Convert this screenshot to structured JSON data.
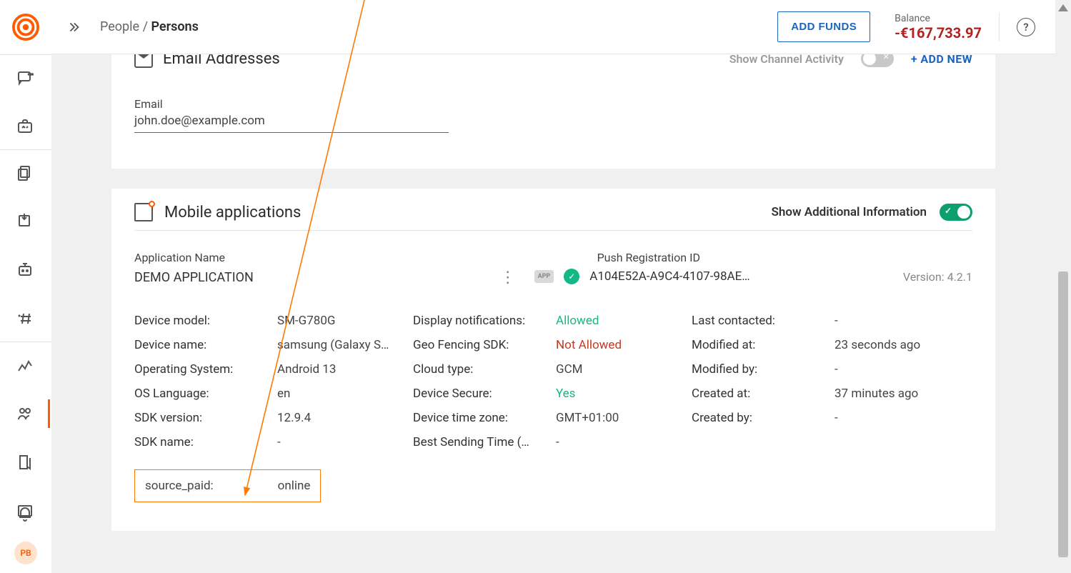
{
  "breadcrumb": {
    "root": "People",
    "sep": "/",
    "leaf": "Persons"
  },
  "header": {
    "add_funds": "ADD FUNDS",
    "balance_label": "Balance",
    "balance_value": "-€167,733.97"
  },
  "avatar": "PB",
  "email_section": {
    "title": "Email Addresses",
    "show_activity": "Show Channel Activity",
    "add_new": "+ ADD NEW",
    "field_label": "Email",
    "field_value": "john.doe@example.com"
  },
  "mobile_section": {
    "title": "Mobile applications",
    "show_info": "Show Additional Information",
    "app_name_label": "Application Name",
    "app_name": "DEMO APPLICATION",
    "push_label": "Push Registration ID",
    "app_badge": "APP",
    "push_id": "A104E52A-A9C4-4107-98AE…",
    "version": "Version: 4.2.1",
    "rows": {
      "device_model_l": "Device model:",
      "device_model_v": "SM-G780G",
      "device_name_l": "Device name:",
      "device_name_v": "samsung (Galaxy S…",
      "os_l": "Operating System:",
      "os_v": "Android 13",
      "os_lang_l": "OS Language:",
      "os_lang_v": "en",
      "sdk_ver_l": "SDK version:",
      "sdk_ver_v": "12.9.4",
      "sdk_name_l": "SDK name:",
      "sdk_name_v": "-",
      "disp_notif_l": "Display notifications:",
      "disp_notif_v": "Allowed",
      "geo_l": "Geo Fencing SDK:",
      "geo_v": "Not Allowed",
      "cloud_l": "Cloud type:",
      "cloud_v": "GCM",
      "secure_l": "Device Secure:",
      "secure_v": "Yes",
      "tz_l": "Device time zone:",
      "tz_v": "GMT+01:00",
      "best_l": "Best Sending Time (…",
      "best_v": "-",
      "last_l": "Last contacted:",
      "last_v": "-",
      "mod_at_l": "Modified at:",
      "mod_at_v": "23 seconds ago",
      "mod_by_l": "Modified by:",
      "mod_by_v": "-",
      "created_at_l": "Created at:",
      "created_at_v": "37 minutes ago",
      "created_by_l": "Created by:",
      "created_by_v": "-"
    },
    "highlight_label": "source_paid:",
    "highlight_value": "online"
  }
}
